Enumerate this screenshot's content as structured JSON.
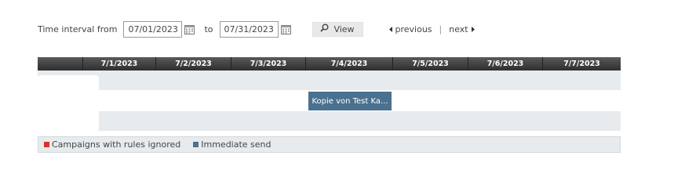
{
  "toolbar": {
    "from_label": "Time interval from",
    "from_value": "07/01/2023",
    "to_label": "to",
    "to_value": "07/31/2023",
    "view_label": "View",
    "previous_label": "previous",
    "separator": "|",
    "next_label": "next"
  },
  "timeline": {
    "days": [
      "7/1/2023",
      "7/2/2023",
      "7/3/2023",
      "7/4/2023",
      "7/5/2023",
      "7/6/2023",
      "7/7/2023"
    ],
    "event": {
      "label": "Kopie von Test Ka...",
      "color": "#4a718f"
    }
  },
  "legend": {
    "items": [
      {
        "label": "Campaigns with rules ignored",
        "color": "#d9342b"
      },
      {
        "label": "Immediate send",
        "color": "#4a718f"
      }
    ]
  },
  "icons": {
    "calendar": "calendar-icon",
    "search": "search-icon",
    "prev": "caret-left-icon",
    "next": "caret-right-icon"
  }
}
